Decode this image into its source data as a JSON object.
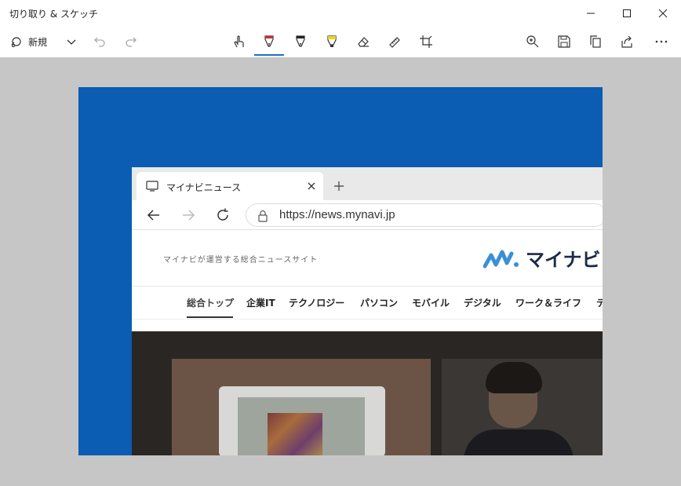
{
  "window": {
    "title": "切り取り & スケッチ"
  },
  "toolbar": {
    "new_label": "新規"
  },
  "browser": {
    "tab_title": "マイナビニュース",
    "url": "https://news.mynavi.jp"
  },
  "site": {
    "tagline": "マイナビが運営する総合ニュースサイト",
    "logo_text": "マイナビ",
    "nav": [
      {
        "label": "総合トップ"
      },
      {
        "label": "企業IT"
      },
      {
        "label": "テクノロジー"
      },
      {
        "label": "パソコン"
      },
      {
        "label": "モバイル"
      },
      {
        "label": "デジタル"
      },
      {
        "label": "ワーク＆ライフ"
      },
      {
        "label": "テ"
      }
    ]
  },
  "colors": {
    "accent": "#1a73c8",
    "capture_bg": "#0a5db3",
    "logo_blue": "#3a8fd8"
  }
}
